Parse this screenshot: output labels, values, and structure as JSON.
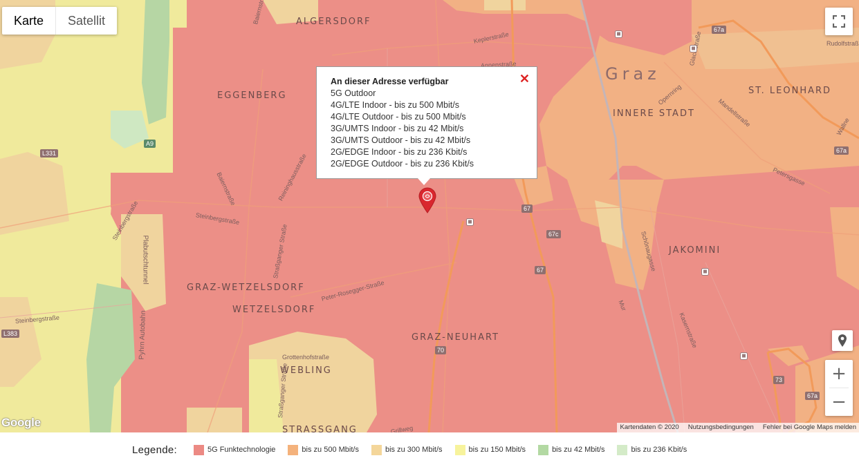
{
  "map_type": {
    "map_label": "Karte",
    "satellite_label": "Satellit"
  },
  "info_window": {
    "title": "An dieser Adresse verfügbar",
    "lines": [
      "5G Outdoor",
      "4G/LTE Indoor - bis zu 500 Mbit/s",
      "4G/LTE Outdoor - bis zu 500 Mbit/s",
      "3G/UMTS Indoor - bis zu 42 Mbit/s",
      "3G/UMTS Outdoor - bis zu 42 Mbit/s",
      "2G/EDGE Indoor - bis zu 236 Kbit/s",
      "2G/EDGE Outdoor - bis zu 236 Kbit/s"
    ],
    "close_icon": "close-icon"
  },
  "districts": {
    "algersdorf": "ALGERSDORF",
    "eggenberg": "EGGENBERG",
    "graz": "Graz",
    "innere_stadt": "INNERE STADT",
    "st_leonhard": "ST. LEONHARD",
    "jakomini": "JAKOMINI",
    "graz_wetzelsdorf": "GRAZ-WETZELSDORF",
    "wetzelsdorf": "WETZELSDORF",
    "graz_neuhart": "GRAZ-NEUHART",
    "webling": "WEBLING",
    "strassgang": "STRASSGANG"
  },
  "streets": {
    "baiernstrasse_top": "Baiernstraße",
    "keplerstrasse": "Keplerstraße",
    "annenstrasse": "Annenstraße",
    "glacisstrasse": "Glacisstraße",
    "rudolfstrasse": "Rudolfstraß",
    "opernring": "Opernring",
    "mandellstrasse": "Mandellstraße",
    "wallner": "Wallne",
    "petersgasse": "Petersgasse",
    "baiernstrasse": "Baiernstraße",
    "reininghausstrasse": "Reininghausstraße",
    "steinbergstrasse_left": "Steinbergstraße",
    "steinbergstrasse_mid": "Steinbergstraße",
    "plabutschtunnel": "Plabutschtunnel",
    "strassganger_strasse": "Straßganger Straße",
    "peter_rosegger": "Peter-Rosegger-Straße",
    "steinbergstrasse_low": "Steinbergstraße",
    "pyhrn_autobahn": "Pyhrn Autobahn",
    "grottenhofstrasse": "Grottenhofstraße",
    "strassganger_low": "Straßganger Straße",
    "schoenaugasse": "Schönaugasse",
    "mur": "Mur",
    "kasernstrasse": "Kasernstraße",
    "grillweg": "Grillweg"
  },
  "shields": {
    "a9": "A9",
    "l331": "L331",
    "l383": "L383",
    "r67a_top": "67a",
    "r67a_right": "67a",
    "r67": "67",
    "r67c": "67c",
    "r67_low": "67",
    "r70": "70",
    "r73": "73",
    "r67a_bottom": "67a"
  },
  "attribution": {
    "google": "Google",
    "map_data": "Kartendaten © 2020",
    "terms": "Nutzungsbedingungen",
    "report": "Fehler bei Google Maps melden"
  },
  "controls": {
    "fullscreen_icon": "fullscreen-icon",
    "pegman_icon": "location-pin-icon",
    "zoom_in": "+",
    "zoom_out": "−"
  },
  "legend": {
    "title": "Legende:",
    "items": [
      {
        "label": "5G Funktechnologie",
        "color": "#ec8a84"
      },
      {
        "label": "bis zu 500 Mbit/s",
        "color": "#f4b27c"
      },
      {
        "label": "bis zu 300 Mbit/s",
        "color": "#f4d69a"
      },
      {
        "label": "bis zu 150 Mbit/s",
        "color": "#f7f39c"
      },
      {
        "label": "bis zu 42 Mbit/s",
        "color": "#b3d9a3"
      },
      {
        "label": "bis zu 236 Kbit/s",
        "color": "#d4ebc8"
      }
    ]
  },
  "colors": {
    "fiveg": "#ec8f87",
    "mbit500": "#f2b184",
    "mbit300": "#f0d49e",
    "mbit150": "#f2ee9e",
    "mbit42": "#b6d6a4",
    "kbit236": "#cfe8c2",
    "road": "#f29a5a",
    "marker": "#d9272e"
  }
}
